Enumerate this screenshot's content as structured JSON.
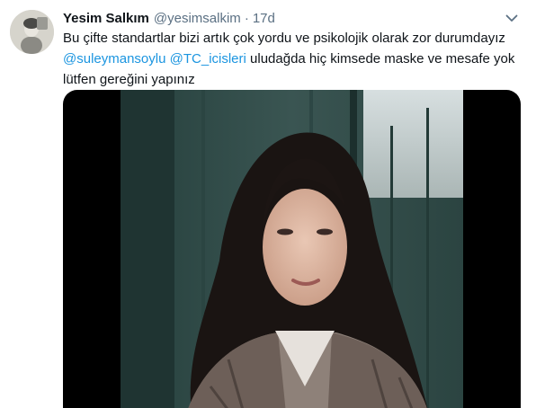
{
  "tweet": {
    "author_name": "Yesim Salkım",
    "handle": "@yesimsalkim",
    "separator": "·",
    "time": "17d",
    "text_line1": "Bu çifte standartlar bizi artık çok yordu ve psikolojik olarak zor durumdayız",
    "mention1": "@suleymansoylu",
    "mention2": "@TC_icisleri",
    "text_line2_rest": "uludağda hiç kimsede maske ve mesafe yok",
    "text_line3": "lütfen gereğini yapınız"
  },
  "colors": {
    "mention": "#1b95e0",
    "secondary_text": "#5b7083",
    "primary_text": "#0f1419"
  },
  "icons": {
    "more": "chevron-down-icon"
  }
}
